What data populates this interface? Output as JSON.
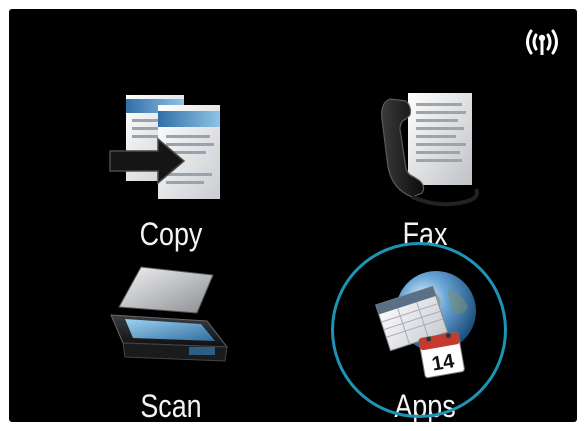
{
  "status_bar": {
    "wireless_icon": "wireless-signal-icon",
    "wireless_label": "(( I ))"
  },
  "tiles": [
    {
      "label": "Copy",
      "icon": "copy-icon"
    },
    {
      "label": "Fax",
      "icon": "fax-icon"
    },
    {
      "label": "Scan",
      "icon": "scan-icon"
    },
    {
      "label": "Apps",
      "icon": "apps-icon",
      "selected": true
    }
  ],
  "apps_icon": {
    "calendar_day": "14"
  },
  "colors": {
    "screen_background": "#000000",
    "label_text": "#f4f4f4",
    "highlight_ring": "#1e94b4"
  }
}
